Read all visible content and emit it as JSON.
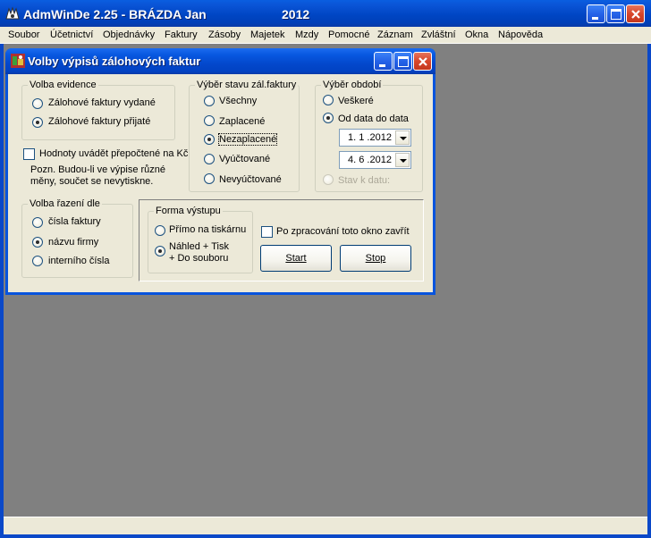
{
  "app": {
    "title": "AdmWinDe 2.25 - BRÁZDA Jan",
    "year": "2012",
    "menu": [
      "Soubor",
      "Účetnictví",
      "Objednávky",
      "Faktury",
      "Zásoby",
      "Majetek",
      "Mzdy",
      "Pomocné",
      "Záznam",
      "Zvláštní",
      "Okna",
      "Nápověda"
    ]
  },
  "dialog": {
    "title": "Volby výpisů zálohových faktur",
    "evidence": {
      "legend": "Volba evidence",
      "options": [
        "Zálohové faktury vydané",
        "Zálohové faktury přijaté"
      ],
      "selected": "Zálohové faktury přijaté"
    },
    "convert": {
      "label": "Hodnoty uvádět přepočtené na Kč",
      "checked": false,
      "note_line1": "Pozn. Budou-li ve výpise různé",
      "note_line2": "měny, součet se nevytiskne."
    },
    "sort": {
      "legend": "Volba řazení dle",
      "options": [
        "čísla faktury",
        "názvu firmy",
        "interního čísla"
      ],
      "selected": "názvu firmy"
    },
    "status": {
      "legend": "Výběr stavu zál.faktury",
      "options": [
        "Všechny",
        "Zaplacené",
        "Nezaplacené",
        "Vyúčtované",
        "Nevyúčtované"
      ],
      "selected": "Nezaplacené"
    },
    "period": {
      "legend": "Výběr období",
      "options": [
        "Veškeré",
        "Od data do data",
        "Stav k datu:"
      ],
      "selected": "Od data do data",
      "date_from": "1. 1 .2012",
      "date_to": "4. 6 .2012"
    },
    "output": {
      "legend": "Forma výstupu",
      "options": [
        "Přímo na tiskárnu",
        "Náhled + Tisk\n+ Do souboru"
      ],
      "option2_line1": "Náhled + Tisk",
      "option2_line2": "+ Do souboru",
      "selected": "Náhled + Tisk + Do souboru"
    },
    "close_after": {
      "label": "Po zpracování toto okno zavřít",
      "checked": false
    },
    "buttons": {
      "start": "Start",
      "stop": "Stop"
    }
  }
}
